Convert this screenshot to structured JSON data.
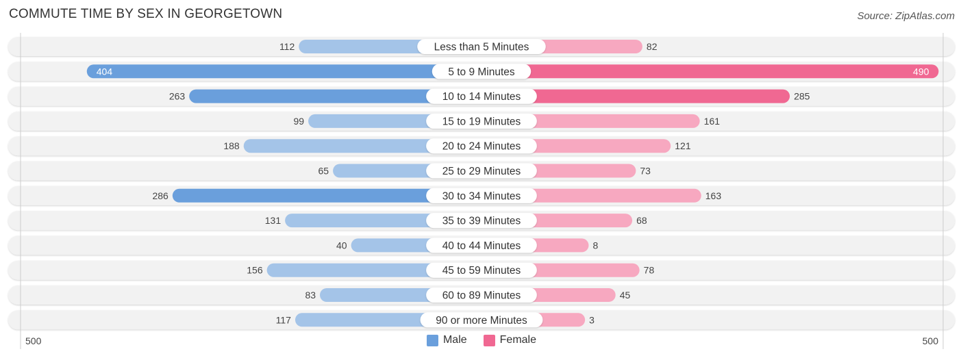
{
  "title": "COMMUTE TIME BY SEX IN GEORGETOWN",
  "source": "Source: ZipAtlas.com",
  "colors": {
    "male_strong": "#6a9fdc",
    "male_light": "#a4c4e8",
    "female_strong": "#f06892",
    "female_light": "#f7a8c0",
    "track": "#f2f2f2"
  },
  "legend": [
    {
      "label": "Male",
      "color": "#6a9fdc"
    },
    {
      "label": "Female",
      "color": "#f06892"
    }
  ],
  "axis": {
    "left_label": "500",
    "right_label": "500"
  },
  "chart_data": {
    "type": "bar",
    "orientation": "horizontal-butterfly",
    "title": "COMMUTE TIME BY SEX IN GEORGETOWN",
    "categories": [
      "Less than 5 Minutes",
      "5 to 9 Minutes",
      "10 to 14 Minutes",
      "15 to 19 Minutes",
      "20 to 24 Minutes",
      "25 to 29 Minutes",
      "30 to 34 Minutes",
      "35 to 39 Minutes",
      "40 to 44 Minutes",
      "45 to 59 Minutes",
      "60 to 89 Minutes",
      "90 or more Minutes"
    ],
    "series": [
      {
        "name": "Male",
        "values": [
          112,
          404,
          263,
          99,
          188,
          65,
          286,
          131,
          40,
          156,
          83,
          117
        ]
      },
      {
        "name": "Female",
        "values": [
          82,
          490,
          285,
          161,
          121,
          73,
          163,
          68,
          8,
          78,
          45,
          3
        ]
      }
    ],
    "xlim": [
      -500,
      500
    ],
    "xlabel": "",
    "ylabel": "",
    "legend_position": "bottom-center"
  }
}
